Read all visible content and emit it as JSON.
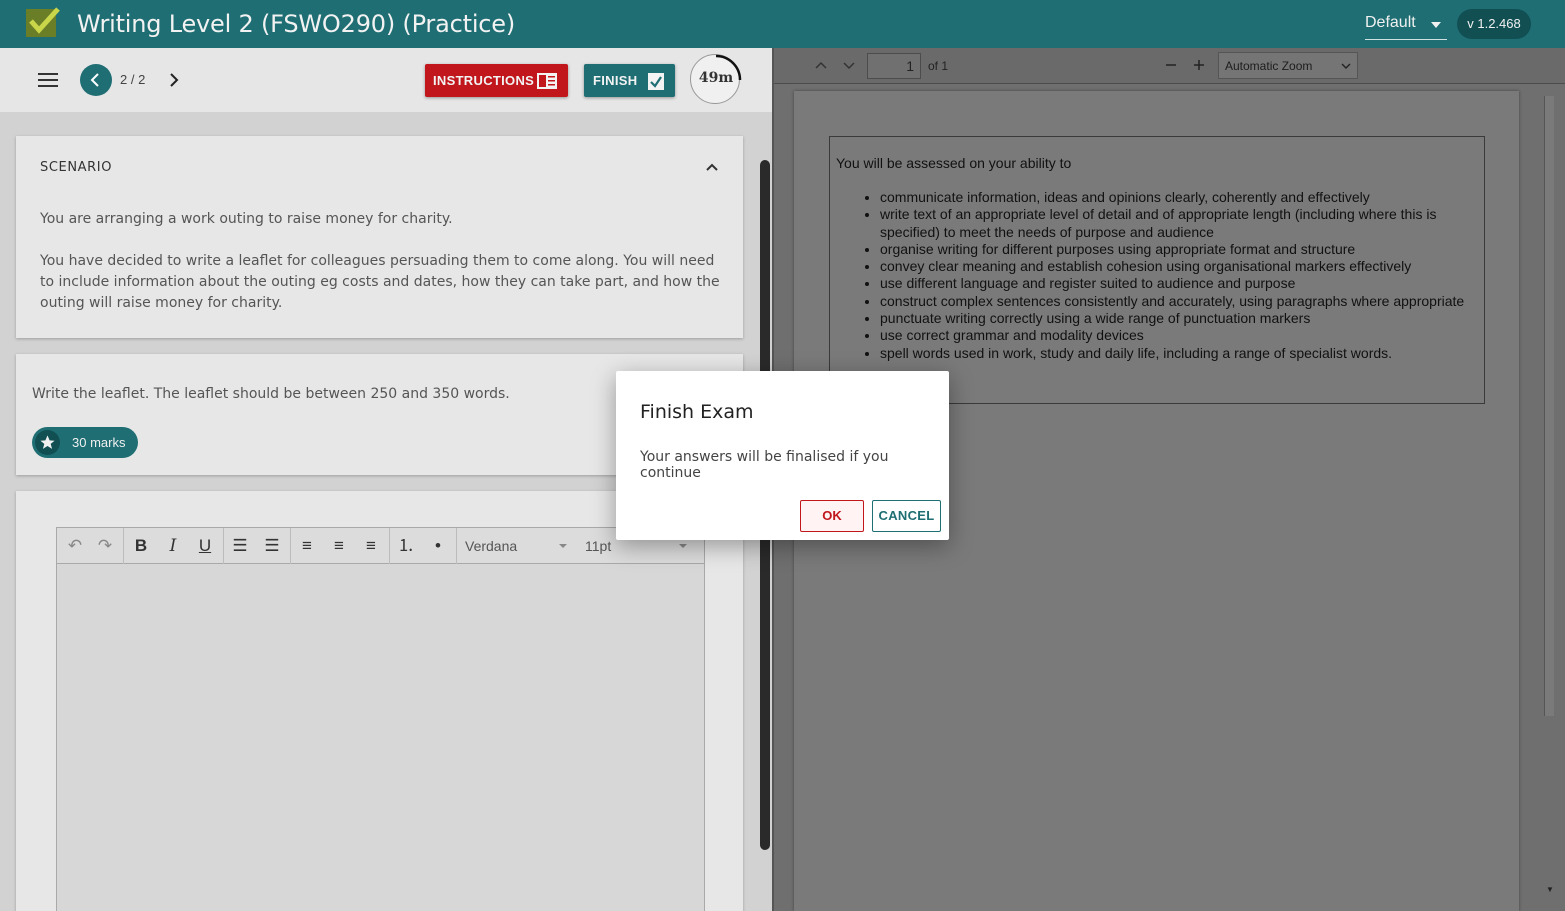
{
  "app": {
    "title": "Writing Level 2 (FSWO290) (Practice)",
    "theme": "Default",
    "version": "v 1.2.468"
  },
  "toolbar": {
    "page_indicator": "2 / 2",
    "instructions_label": "INSTRUCTIONS",
    "finish_label": "FINISH",
    "timer": "49m"
  },
  "scenario": {
    "heading": "SCENARIO",
    "paragraph_1": "You are arranging a work outing to raise money for charity.",
    "paragraph_2": "You have decided to write a leaflet for colleagues persuading them to come along. You will need to include information about the outing eg costs and dates, how they can take part, and how the outing will raise money for charity."
  },
  "question": {
    "text": "Write the leaflet. The leaflet should be between 250 and 350 words.",
    "marks": "30 marks"
  },
  "editor": {
    "font": "Verdana",
    "font_size": "11pt"
  },
  "pdf": {
    "page_number": "1",
    "page_of": "of 1",
    "zoom": "Automatic Zoom",
    "intro": "You will be assessed on your ability to",
    "items": [
      "communicate information, ideas and opinions clearly, coherently and effectively",
      "write text of an appropriate level of detail and of appropriate length (including where this is specified) to meet the needs of purpose and audience",
      "organise writing for different purposes using appropriate format and structure",
      "convey clear meaning and establish cohesion using organisational markers effectively",
      "use different language and register suited to audience and purpose",
      "construct complex sentences consistently and accurately, using paragraphs where appropriate",
      "punctuate writing correctly using a wide range of punctuation markers",
      "use correct grammar and modality devices",
      "spell words used in work, study and daily life, including a range of specialist words."
    ]
  },
  "modal": {
    "title": "Finish Exam",
    "message": "Your answers will be finalised if you continue",
    "ok_label": "OK",
    "cancel_label": "CANCEL"
  },
  "colors": {
    "brand": "#1e6e73",
    "danger": "#c0161c"
  }
}
